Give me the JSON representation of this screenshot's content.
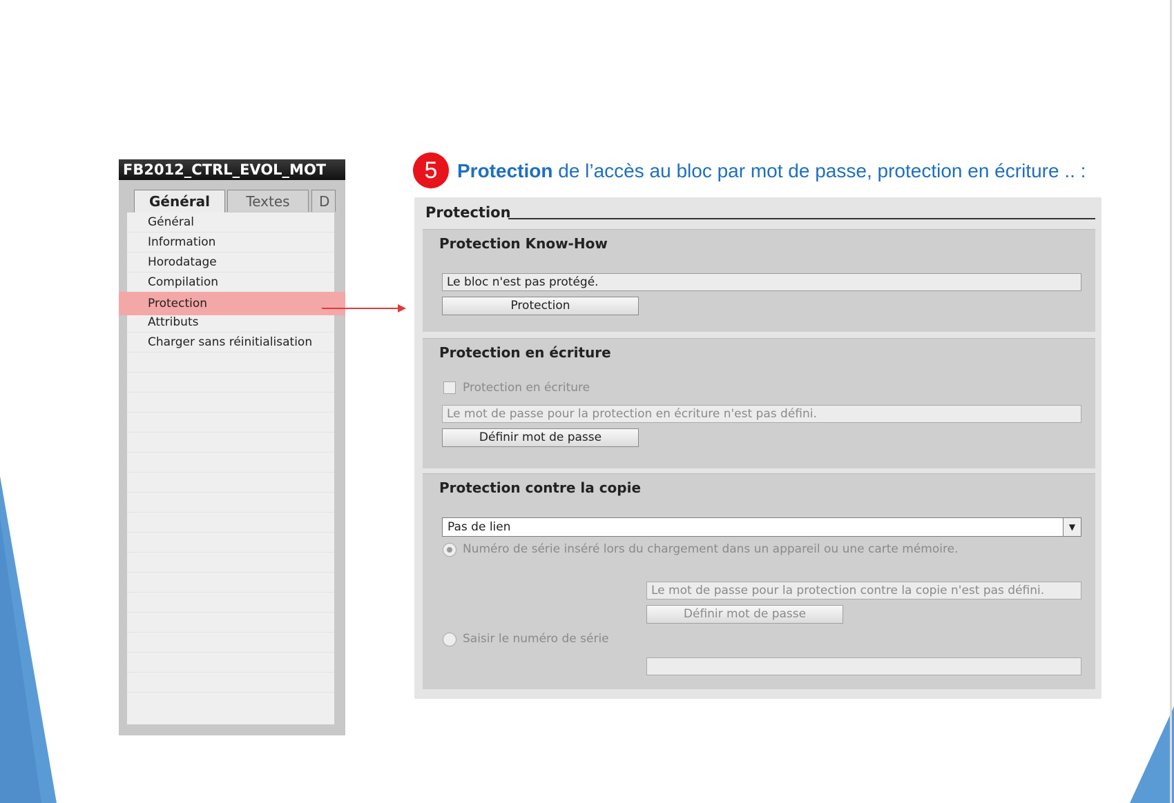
{
  "colors": {
    "accent_blue": "#1e6fc0",
    "badge_red": "#e8141b",
    "highlight_pink": "#f4a7a7",
    "arrow_red": "#e23a3a",
    "deco_blue": "#5b9bd5"
  },
  "heading": {
    "step": "5",
    "bold": "Protection",
    "rest": " de l’accès au bloc par mot de passe, protection en écriture  .. :"
  },
  "left_panel": {
    "title": "FB2012_CTRL_EVOL_MOT",
    "tabs": [
      "Général",
      "Textes",
      "D"
    ],
    "items": [
      "Général",
      "Information",
      "Horodatage",
      "Compilation",
      "Protection",
      "Attributs",
      "Charger sans réinitialisation"
    ],
    "selected_item": "Protection"
  },
  "right_panel": {
    "title": "Protection",
    "know_how": {
      "title": "Protection Know-How",
      "status": "Le bloc n'est pas protégé.",
      "button": "Protection"
    },
    "write": {
      "title": "Protection en écriture",
      "checkbox_label": "Protection en écriture",
      "status": "Le mot de passe pour la protection en écriture n'est pas défini.",
      "button": "Définir mot de passe"
    },
    "copy": {
      "title": "Protection contre la copie",
      "select_value": "Pas de lien",
      "option1": "Numéro de série inséré lors du chargement dans un appareil ou une carte mémoire.",
      "status": "Le mot de passe pour la protection contre la copie n'est pas défini.",
      "button": "Définir mot de passe",
      "option2": "Saisir le numéro de série",
      "serial_value": ""
    }
  }
}
